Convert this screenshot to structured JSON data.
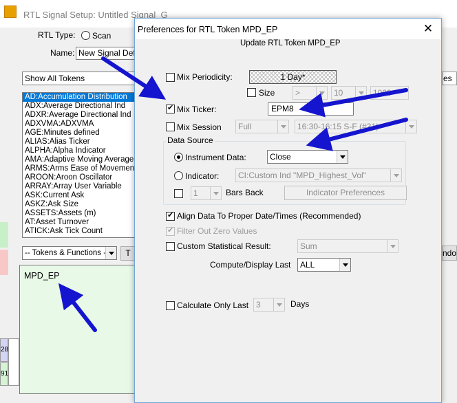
{
  "background_window": {
    "title": "RTL Signal Setup: Untitled Signal_G",
    "rtl_type_label": "RTL Type:",
    "scan_option": "Scan",
    "name_label": "Name:",
    "name_value": "New Signal Defin",
    "token_filter": "Show All Tokens",
    "tokens": [
      "AD:Accumulation Distribution",
      "ADX:Average Directional Ind",
      "ADXR:Average Directional Ind",
      "ADXVMA:ADXVMA",
      "AGE:Minutes defined",
      "ALIAS:Alias Ticker",
      "ALPHA:Alpha Indicator",
      "AMA:Adaptive Moving Average",
      "ARMS:Arms Ease of Movement",
      "AROON:Aroon Oscillator",
      "ARRAY:Array User Variable",
      "ASK:Current Ask",
      "ASKZ:Ask Size",
      "ASSETS:Assets (m)",
      "AT:Asset Turnover",
      "ATICK:Ask Tick Count"
    ],
    "tokens_functions_combo": "-- Tokens & Functions --",
    "t_button": "T",
    "editor_text": "MPD_EP",
    "right_partial_header": "es",
    "right_partial_button": "ndo",
    "left_cells": [
      "28",
      "91"
    ]
  },
  "dialog": {
    "title": "Preferences for RTL Token MPD_EP",
    "close_glyph": "✕",
    "subtitle": "Update RTL Token MPD_EP",
    "mix_periodicity": {
      "label": "Mix Periodicity:",
      "checked": false,
      "value": "1 Day*"
    },
    "size": {
      "label": "Size",
      "checked": false,
      "op": ">",
      "value": "10",
      "extra": "1000"
    },
    "mix_ticker": {
      "label": "Mix Ticker:",
      "checked": true,
      "value": "EPM8"
    },
    "mix_session": {
      "label": "Mix Session",
      "checked": false,
      "session": "Full",
      "hours": "16:30-16:15 S-F (#31)"
    },
    "data_source": {
      "group_label": "Data Source",
      "instrument_label": "Instrument Data:",
      "instrument_value": "Close",
      "indicator_label": "Indicator:",
      "indicator_value": "CI:Custom Ind \"MPD_Highest_Vol\"",
      "bars_back_value": "1",
      "bars_back_label": "Bars Back",
      "indicator_prefs_button": "Indicator Preferences"
    },
    "align_label": "Align Data To Proper Date/Times (Recommended)",
    "filter_zero_label": "Filter Out Zero Values",
    "custom_stat": {
      "label": "Custom Statistical Result:",
      "value": "Sum"
    },
    "compute_display": {
      "label": "Compute/Display Last",
      "value": "ALL"
    },
    "calc_only_last": {
      "label": "Calculate Only Last",
      "value": "3",
      "unit": "Days"
    }
  },
  "colors": {
    "accent": "#0078d7",
    "arrow": "#1515cf",
    "editor_bg": "#e8f9e8"
  }
}
